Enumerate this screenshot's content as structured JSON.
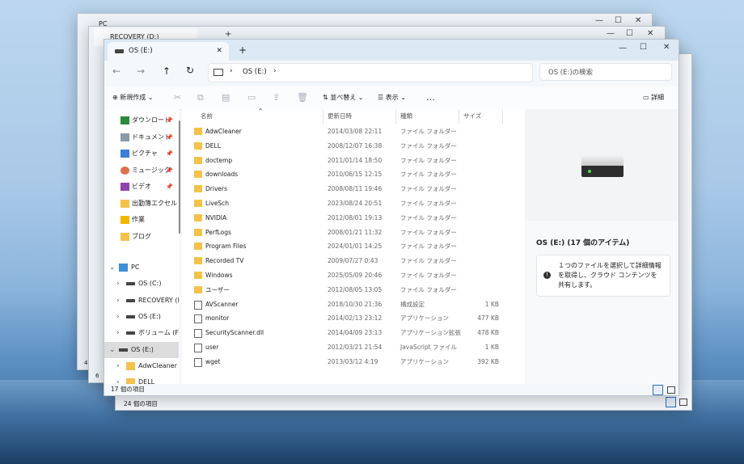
{
  "back_window_1": {
    "tab_title": "PC"
  },
  "back_window_2": {
    "tab_title": "RECOVERY (D:)"
  },
  "back_window_3": {
    "status": "24 個の項目"
  },
  "back_window_partial": {
    "left_counts": [
      "4",
      "6"
    ]
  },
  "window": {
    "tab_title": "OS (E:)",
    "new_tab": "+",
    "controls": {
      "minimize": "—",
      "maximize": "☐",
      "close": "✕"
    }
  },
  "nav": {
    "back": "←",
    "forward": "→",
    "up": "↑",
    "refresh": "↻",
    "path": [
      "OS (E:)"
    ],
    "search_placeholder": "OS (E:)の検索"
  },
  "toolbar": {
    "new": "新規作成",
    "sort": "並べ替え",
    "view": "表示",
    "more": "…",
    "details": "詳細"
  },
  "sidebar": {
    "quick": [
      {
        "label": "ダウンロード",
        "icon": "download-icon",
        "pinned": true
      },
      {
        "label": "ドキュメント",
        "icon": "document-icon",
        "pinned": true
      },
      {
        "label": "ピクチャ",
        "icon": "picture-icon",
        "pinned": true
      },
      {
        "label": "ミュージック",
        "icon": "music-icon",
        "pinned": true
      },
      {
        "label": "ビデオ",
        "icon": "video-icon",
        "pinned": true
      },
      {
        "label": "出勤簿エクセル",
        "icon": "folder-icon",
        "pinned": false
      },
      {
        "label": "作業",
        "icon": "star-icon",
        "pinned": false
      },
      {
        "label": "ブログ",
        "icon": "folder-icon",
        "pinned": false
      }
    ],
    "tree": [
      {
        "label": "PC",
        "icon": "pc-icon",
        "chev": "⌄",
        "indent": 0
      },
      {
        "label": "OS (C:)",
        "icon": "drive-icon",
        "chev": "›",
        "indent": 1
      },
      {
        "label": "RECOVERY (D:)",
        "icon": "drive-icon",
        "chev": "›",
        "indent": 1
      },
      {
        "label": "OS (E:)",
        "icon": "drive-icon",
        "chev": "›",
        "indent": 1
      },
      {
        "label": "ボリューム (F:)",
        "icon": "drive-icon",
        "chev": "›",
        "indent": 1
      },
      {
        "label": "OS (E:)",
        "icon": "drive-icon",
        "chev": "⌄",
        "indent": 0,
        "selected": true
      },
      {
        "label": "AdwCleaner",
        "icon": "folder-icon",
        "chev": "›",
        "indent": 1
      },
      {
        "label": "DELL",
        "icon": "folder-icon",
        "chev": "›",
        "indent": 1
      }
    ]
  },
  "columns": {
    "name": "名前",
    "modified": "更新日時",
    "type": "種類",
    "size": "サイズ"
  },
  "files": [
    {
      "name": "AdwCleaner",
      "modified": "2014/03/08 22:11",
      "type": "ファイル フォルダー",
      "size": "",
      "icon": "folder"
    },
    {
      "name": "DELL",
      "modified": "2008/12/07 16:38",
      "type": "ファイル フォルダー",
      "size": "",
      "icon": "folder"
    },
    {
      "name": "doctemp",
      "modified": "2011/01/14 18:50",
      "type": "ファイル フォルダー",
      "size": "",
      "icon": "folder"
    },
    {
      "name": "downloads",
      "modified": "2010/06/15 12:15",
      "type": "ファイル フォルダー",
      "size": "",
      "icon": "folder"
    },
    {
      "name": "Drivers",
      "modified": "2008/08/11 19:46",
      "type": "ファイル フォルダー",
      "size": "",
      "icon": "folder"
    },
    {
      "name": "LiveSch",
      "modified": "2023/08/24 20:51",
      "type": "ファイル フォルダー",
      "size": "",
      "icon": "folder"
    },
    {
      "name": "NVIDIA",
      "modified": "2012/08/01 19:13",
      "type": "ファイル フォルダー",
      "size": "",
      "icon": "folder"
    },
    {
      "name": "PerfLogs",
      "modified": "2008/01/21 11:32",
      "type": "ファイル フォルダー",
      "size": "",
      "icon": "folder"
    },
    {
      "name": "Program Files",
      "modified": "2024/01/01 14:25",
      "type": "ファイル フォルダー",
      "size": "",
      "icon": "folder"
    },
    {
      "name": "Recorded TV",
      "modified": "2009/07/27 0:43",
      "type": "ファイル フォルダー",
      "size": "",
      "icon": "folder"
    },
    {
      "name": "Windows",
      "modified": "2025/05/09 20:46",
      "type": "ファイル フォルダー",
      "size": "",
      "icon": "folder"
    },
    {
      "name": "ユーザー",
      "modified": "2012/08/05 13:05",
      "type": "ファイル フォルダー",
      "size": "",
      "icon": "folder"
    },
    {
      "name": "AVScanner",
      "modified": "2018/10/30 21:36",
      "type": "構成設定",
      "size": "1 KB",
      "icon": "config"
    },
    {
      "name": "monitor",
      "modified": "2014/02/13 23:12",
      "type": "アプリケーション",
      "size": "477 KB",
      "icon": "app"
    },
    {
      "name": "SecurityScanner.dll",
      "modified": "2014/04/09 23:13",
      "type": "アプリケーション拡張",
      "size": "478 KB",
      "icon": "dll"
    },
    {
      "name": "user",
      "modified": "2012/03/21 21:54",
      "type": "JavaScript ファイル",
      "size": "1 KB",
      "icon": "script"
    },
    {
      "name": "wget",
      "modified": "2013/03/12 4:19",
      "type": "アプリケーション",
      "size": "392 KB",
      "icon": "app"
    }
  ],
  "details_pane": {
    "title": "OS (E:) (17 個のアイテム)",
    "hint": "１つのファイルを選択して詳細情報を取得し、クラウド コンテンツを共有します。"
  },
  "status": {
    "count": "17 個の項目"
  }
}
